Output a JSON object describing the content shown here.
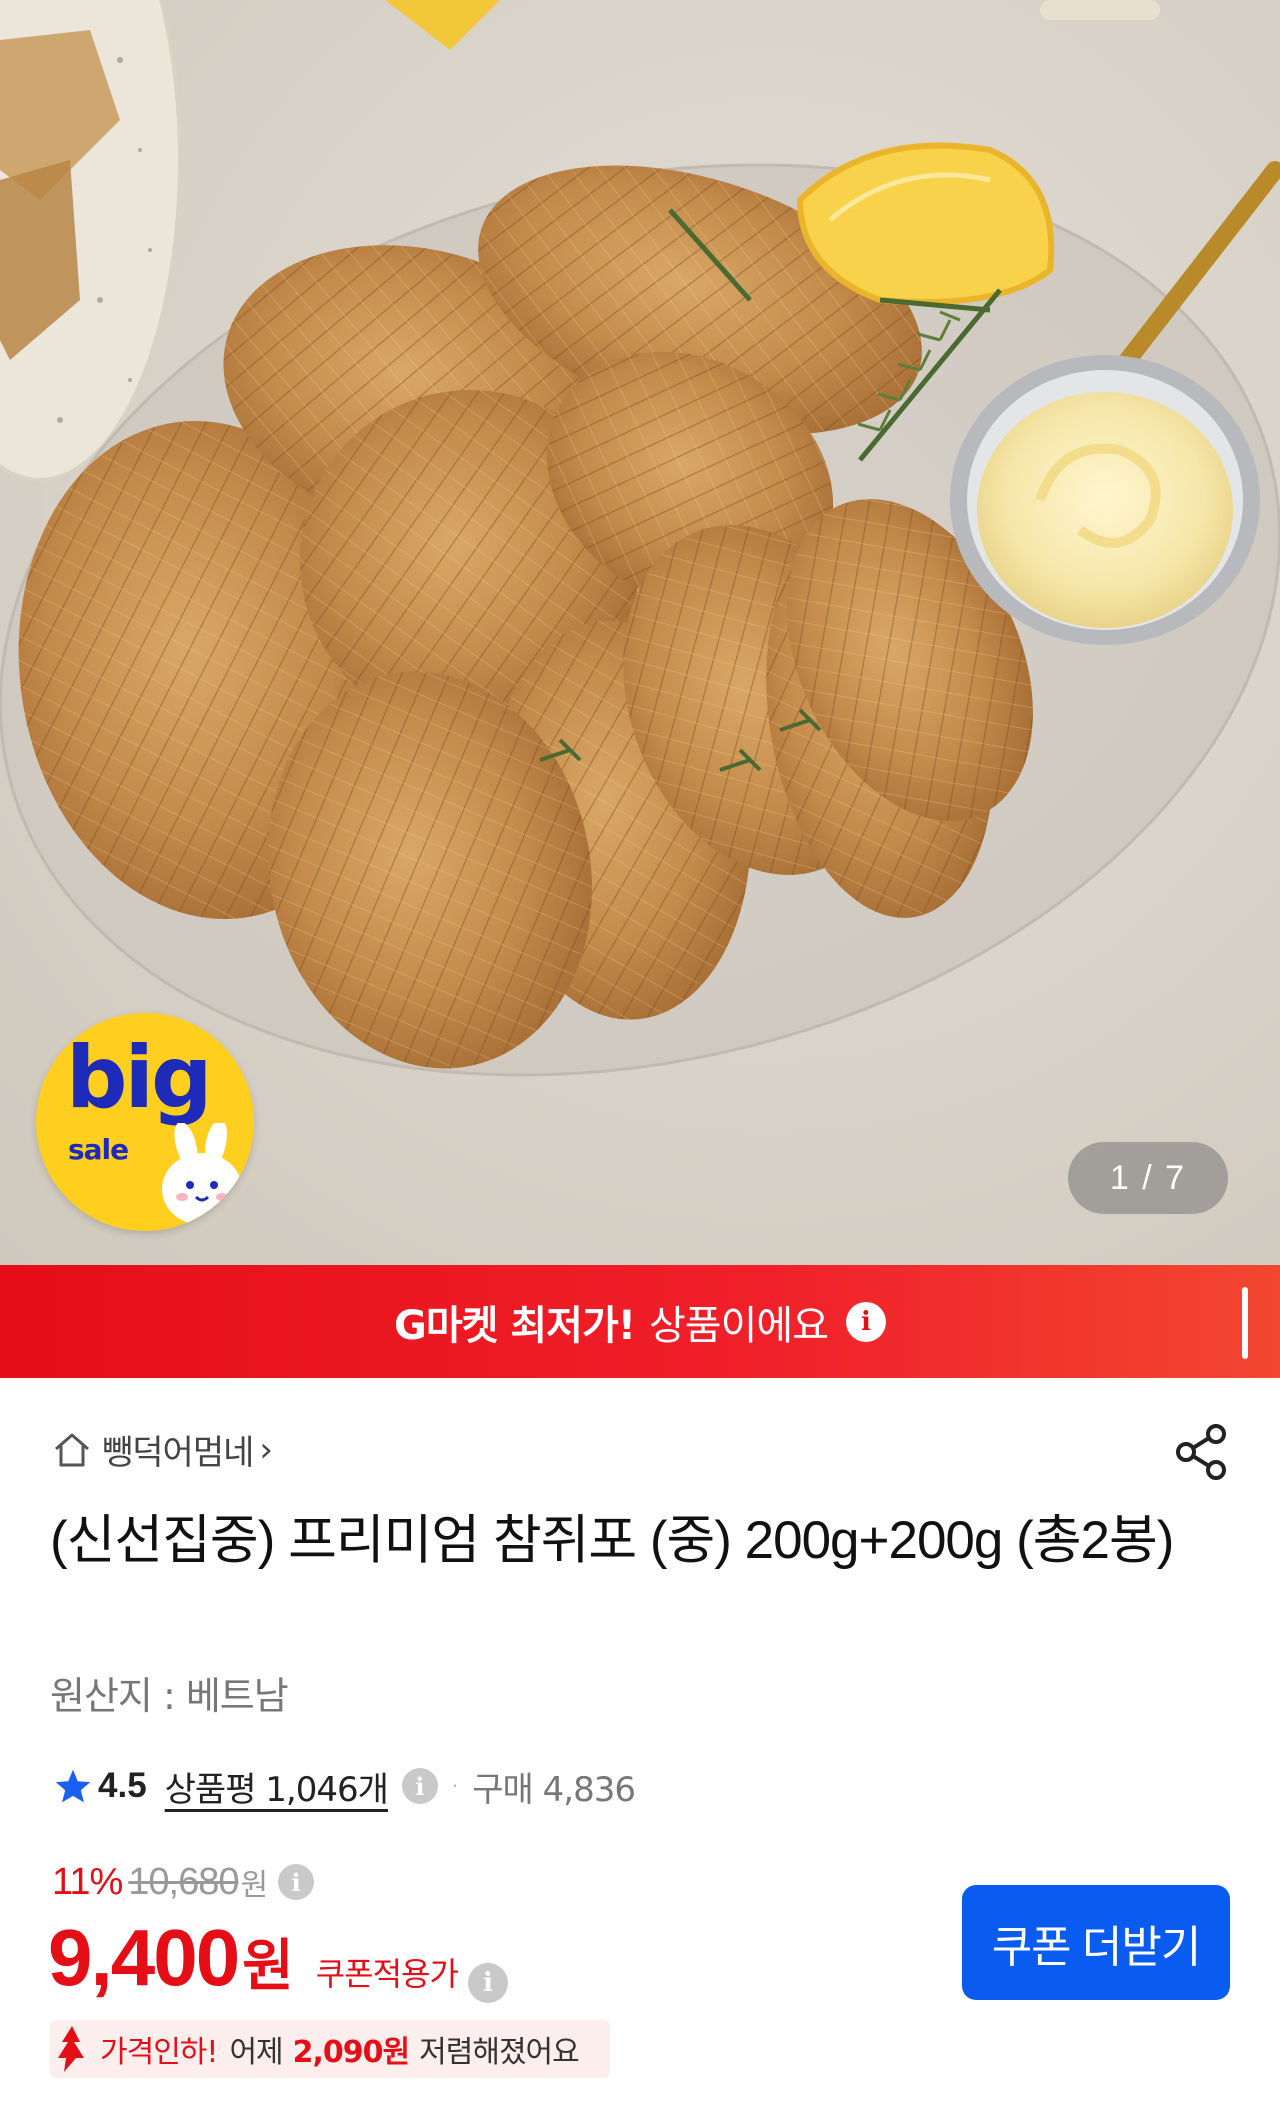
{
  "hero": {
    "badge": {
      "big": "big",
      "sale": "sale"
    },
    "pager": "1 / 7"
  },
  "banner": {
    "brand_text": "G마켓 최저가!",
    "rest_text": "상품이에요",
    "info_icon": "info-icon"
  },
  "seller": {
    "icon": "home-icon",
    "name": "뺑덕어멈네",
    "chevron": "›"
  },
  "share_icon": "share-icon",
  "product": {
    "title": "(신선집중) 프리미엄 참쥐포 (중) 200g+200g (총2봉)",
    "origin": "원산지 : 베트남"
  },
  "rating": {
    "score": "4.5",
    "reviews_label": "상품평 1,046개",
    "dot": "·",
    "purchases": "구매 4,836",
    "star_color": "#1a5ff0"
  },
  "price": {
    "discount_pct": "11%",
    "original_price": "10,680",
    "original_unit": "원",
    "amount": "9,400",
    "unit": "원",
    "coupon_tag": "쿠폰적용가",
    "accent": "#e50e16"
  },
  "coupon_button": {
    "label": "쿠폰 더받기",
    "color": "#0a5bf0"
  },
  "price_drop": {
    "prefix": "가격인하!",
    "text_before": "어제",
    "amount": "2,090원",
    "text_after": "저렴해졌어요"
  }
}
